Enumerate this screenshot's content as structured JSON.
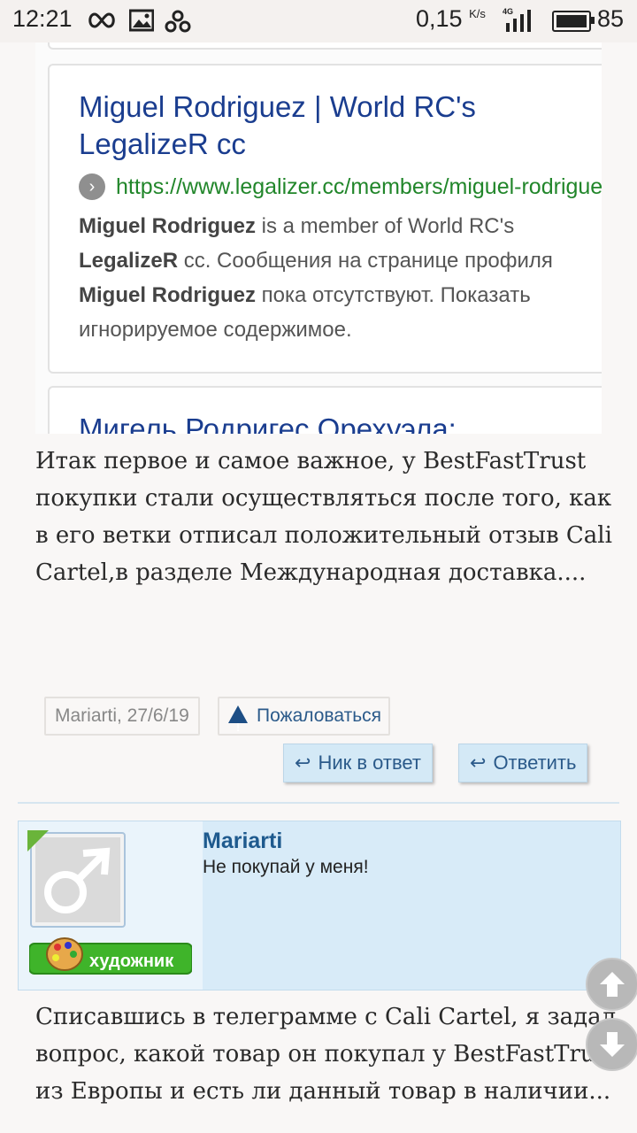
{
  "status_bar": {
    "time": "12:21",
    "net_speed": "0,15",
    "net_speed_unit": "K/s",
    "network_type": "4G",
    "battery": "85"
  },
  "result_card": {
    "title_line1": "Miguel Rodriguez | World RC's",
    "title_line2": "LegalizeR cc",
    "url": "https://www.legalizer.cc/members/miguel-rodriguez",
    "desc_line1_bold": "Miguel Rodriguez",
    "desc_line1_rest": " is a member of World RC's",
    "desc_line2_bold": "LegalizeR",
    "desc_line2_rest": " cc. Сообщения на странице профиля",
    "desc_line3_bold": "Miguel Rodriguez",
    "desc_line3_rest": " пока отсутствуют. Показать",
    "desc_line4": "игнорируемое содержимое.",
    "next_title": "Мигель Родригес Орехуэла:"
  },
  "post_text": "Итак первое и самое важное, у BestFastTrust покупки стали осуществляться после того, как в его ветки отписал положительный отзыв Cali Cartel,в разделе Международная доставка....",
  "meta": {
    "author": "Mariarti",
    "date": ", 27/6/19",
    "report_label": "Пожаловаться"
  },
  "actions": {
    "reply_nick": "Ник в ответ",
    "reply": "Ответить"
  },
  "quote": {
    "author": "Mariarti",
    "text": "Не покупай у меня!",
    "badge_label": "художник"
  },
  "post_text2": "Списавшись в телеграмме с Cali Cartel, я задал вопрос, какой товар он покупал у BestFastTrust из Европы и есть ли данный товар в наличии..."
}
